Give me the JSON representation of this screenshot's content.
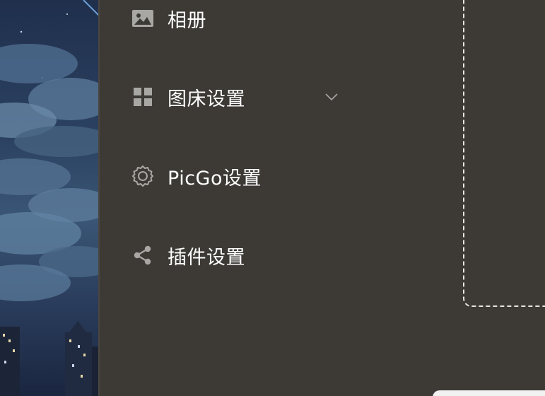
{
  "sidebar": {
    "items": [
      {
        "label": "相册",
        "icon": "image-icon"
      },
      {
        "label": "图床设置",
        "icon": "grid-icon",
        "expandable": true
      },
      {
        "label": "PicGo设置",
        "icon": "gear-icon"
      },
      {
        "label": "插件设置",
        "icon": "share-icon"
      }
    ]
  },
  "colors": {
    "background": "#3d3a36",
    "text": "#ffffff",
    "icon": "#a9a7a4",
    "dashed_border": "#e8e6e2"
  }
}
